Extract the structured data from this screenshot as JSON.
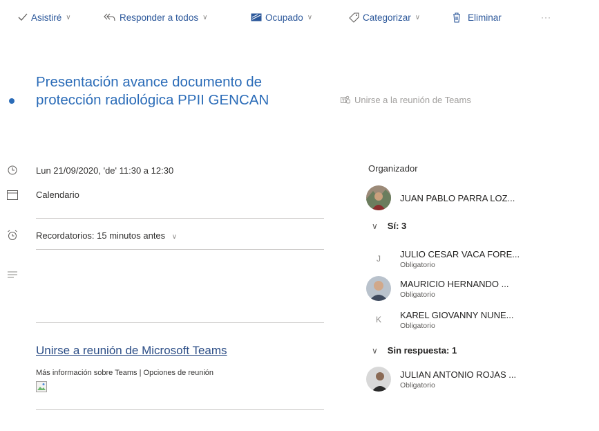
{
  "toolbar": {
    "attend_label": "Asistiré",
    "reply_all_label": "Responder a todos",
    "busy_label": "Ocupado",
    "categorize_label": "Categorizar",
    "delete_label": "Eliminar",
    "more_label": "···"
  },
  "event": {
    "title": "Presentación avance documento de protección radiológica PPII GENCAN",
    "teams_join_label": "Unirse a la reunión de Teams",
    "datetime": "Lun 21/09/2020, 'de' 11:30 a 12:30",
    "calendar": "Calendario",
    "reminder": "Recordatorios: 15 minutos antes"
  },
  "body": {
    "teams_link": "Unirse a reunión de Microsoft Teams",
    "more_info_link": "Más información sobre Teams",
    "separator": "|",
    "meeting_options_link": "Opciones de reunión"
  },
  "attendees": {
    "organizer_label": "Organizador",
    "organizer_name": "JUAN PABLO PARRA LOZ...",
    "yes_group_label": "Sí: 3",
    "no_response_group_label": "Sin respuesta: 1",
    "people": [
      {
        "name": "JULIO CESAR VACA FORE...",
        "role": "Obligatorio",
        "initial": "J"
      },
      {
        "name": "MAURICIO HERNANDO ...",
        "role": "Obligatorio"
      },
      {
        "name": "KAREL GIOVANNY NUNE...",
        "role": "Obligatorio",
        "initial": "K"
      },
      {
        "name": "JULIAN ANTONIO ROJAS ...",
        "role": "Obligatorio"
      }
    ]
  },
  "colors": {
    "accent": "#2b6cb8",
    "toolbar_text": "#2b579a",
    "muted": "#a19f9d"
  }
}
